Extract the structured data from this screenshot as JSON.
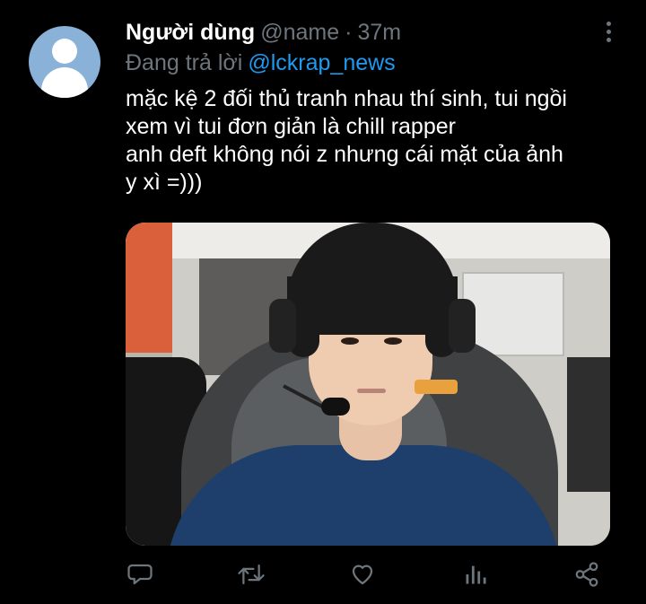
{
  "tweet": {
    "display_name": "Người dùng",
    "handle": "@name",
    "separator": "·",
    "time": "37m",
    "reply_prefix": "Đang trả lời",
    "reply_to": "@lckrap_news",
    "text": "mặc kệ 2 đối thủ tranh nhau thí sinh, tui ngồi\nxem vì tui đơn giản là chill rapper\nanh deft không nói z nhưng cái mặt của ảnh\ny xì =)))"
  },
  "actions": [
    {
      "name": "reply-icon"
    },
    {
      "name": "retweet-icon"
    },
    {
      "name": "like-icon"
    },
    {
      "name": "analytics-icon"
    },
    {
      "name": "share-icon"
    }
  ],
  "colors": {
    "background": "#000000",
    "text": "#ffffff",
    "muted": "#6e767d",
    "link": "#1d9bf0",
    "avatar_bg": "#8ab1d8"
  }
}
